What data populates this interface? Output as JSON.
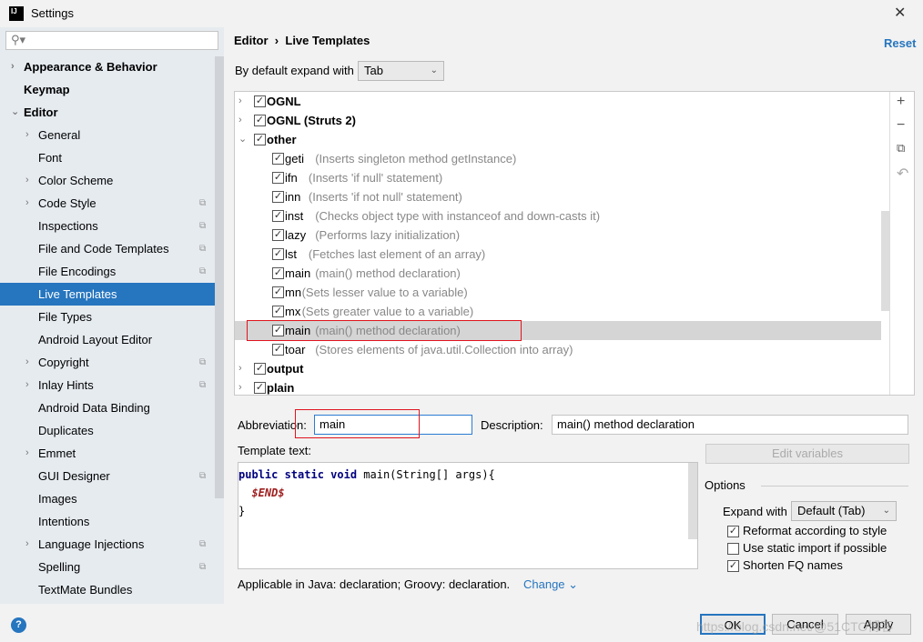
{
  "window": {
    "title": "Settings",
    "logo": "IJ"
  },
  "search": {
    "placeholder": ""
  },
  "sidebar": {
    "items": [
      {
        "label": "Appearance & Behavior",
        "arrow": "›",
        "bold": true
      },
      {
        "label": "Keymap",
        "bold": true
      },
      {
        "label": "Editor",
        "arrow": "⌄",
        "bold": true
      },
      {
        "label": "General",
        "arrow": "›"
      },
      {
        "label": "Font"
      },
      {
        "label": "Color Scheme",
        "arrow": "›"
      },
      {
        "label": "Code Style",
        "arrow": "›",
        "copy": true
      },
      {
        "label": "Inspections",
        "copy": true
      },
      {
        "label": "File and Code Templates",
        "copy": true
      },
      {
        "label": "File Encodings",
        "copy": true
      },
      {
        "label": "Live Templates",
        "selected": true
      },
      {
        "label": "File Types"
      },
      {
        "label": "Android Layout Editor"
      },
      {
        "label": "Copyright",
        "arrow": "›",
        "copy": true
      },
      {
        "label": "Inlay Hints",
        "arrow": "›",
        "copy": true
      },
      {
        "label": "Android Data Binding"
      },
      {
        "label": "Duplicates"
      },
      {
        "label": "Emmet",
        "arrow": "›"
      },
      {
        "label": "GUI Designer",
        "copy": true
      },
      {
        "label": "Images"
      },
      {
        "label": "Intentions"
      },
      {
        "label": "Language Injections",
        "arrow": "›",
        "copy": true
      },
      {
        "label": "Spelling",
        "copy": true
      },
      {
        "label": "TextMate Bundles"
      }
    ]
  },
  "header": {
    "breadcrumb_parent": "Editor",
    "breadcrumb_sep": "›",
    "breadcrumb_current": "Live Templates",
    "reset": "Reset"
  },
  "expand": {
    "label": "By default expand with",
    "value": "Tab"
  },
  "tree": [
    {
      "name": "OGNL",
      "group": true,
      "expanded": false,
      "checked": true
    },
    {
      "name": "OGNL (Struts 2)",
      "group": true,
      "expanded": false,
      "checked": true
    },
    {
      "name": "other",
      "group": true,
      "expanded": true,
      "checked": true
    },
    {
      "name": "geti",
      "desc": "(Inserts singleton method getInstance)",
      "checked": true
    },
    {
      "name": "ifn",
      "desc": "(Inserts 'if null' statement)",
      "checked": true
    },
    {
      "name": "inn",
      "desc": "(Inserts 'if not null' statement)",
      "checked": true
    },
    {
      "name": "inst",
      "desc": "(Checks object type with instanceof and down-casts it)",
      "checked": true
    },
    {
      "name": "lazy",
      "desc": "(Performs lazy initialization)",
      "checked": true
    },
    {
      "name": "lst",
      "desc": "(Fetches last element of an array)",
      "checked": true
    },
    {
      "name": "main",
      "desc": "(main() method declaration)",
      "checked": true
    },
    {
      "name": "mn",
      "desc": "(Sets lesser value to a variable)",
      "checked": true
    },
    {
      "name": "mx",
      "desc": "(Sets greater value to a variable)",
      "checked": true
    },
    {
      "name": "main",
      "desc": "(main() method declaration)",
      "checked": true,
      "selected": true
    },
    {
      "name": "toar",
      "desc": "(Stores elements of java.util.Collection into array)",
      "checked": true
    },
    {
      "name": "output",
      "group": true,
      "expanded": false,
      "checked": true
    },
    {
      "name": "plain",
      "group": true,
      "expanded": false,
      "checked": true
    }
  ],
  "tools": {
    "add": "+",
    "remove": "−",
    "copy": "⧉",
    "revert": "↶"
  },
  "form": {
    "abbr_label": "Abbreviation:",
    "abbr_value": "main",
    "desc_label": "Description:",
    "desc_value": "main() method declaration",
    "template_label": "Template text:",
    "code": {
      "kw": "public static void",
      "rest": " main(String[] args){",
      "end_var": "$END$",
      "close": "}"
    },
    "edit_vars": "Edit variables",
    "options_label": "Options",
    "expand_label": "Expand with",
    "expand_value": "Default (Tab)",
    "options": [
      {
        "label": "Reformat according to style",
        "checked": true
      },
      {
        "label": "Use static import if possible",
        "checked": false
      },
      {
        "label": "Shorten FQ names",
        "checked": true
      }
    ],
    "applicable": "Applicable in Java: declaration; Groovy: declaration.",
    "change": "Change ⌄"
  },
  "footer": {
    "help": "?",
    "ok": "OK",
    "cancel": "Cancel",
    "apply": "Apply",
    "watermark": "https://blog.csdn.net/@51CTO博客"
  },
  "colors": {
    "accent": "#2675bf",
    "highlight_box": "#e0141e",
    "selected_row": "#d5d5d5"
  }
}
